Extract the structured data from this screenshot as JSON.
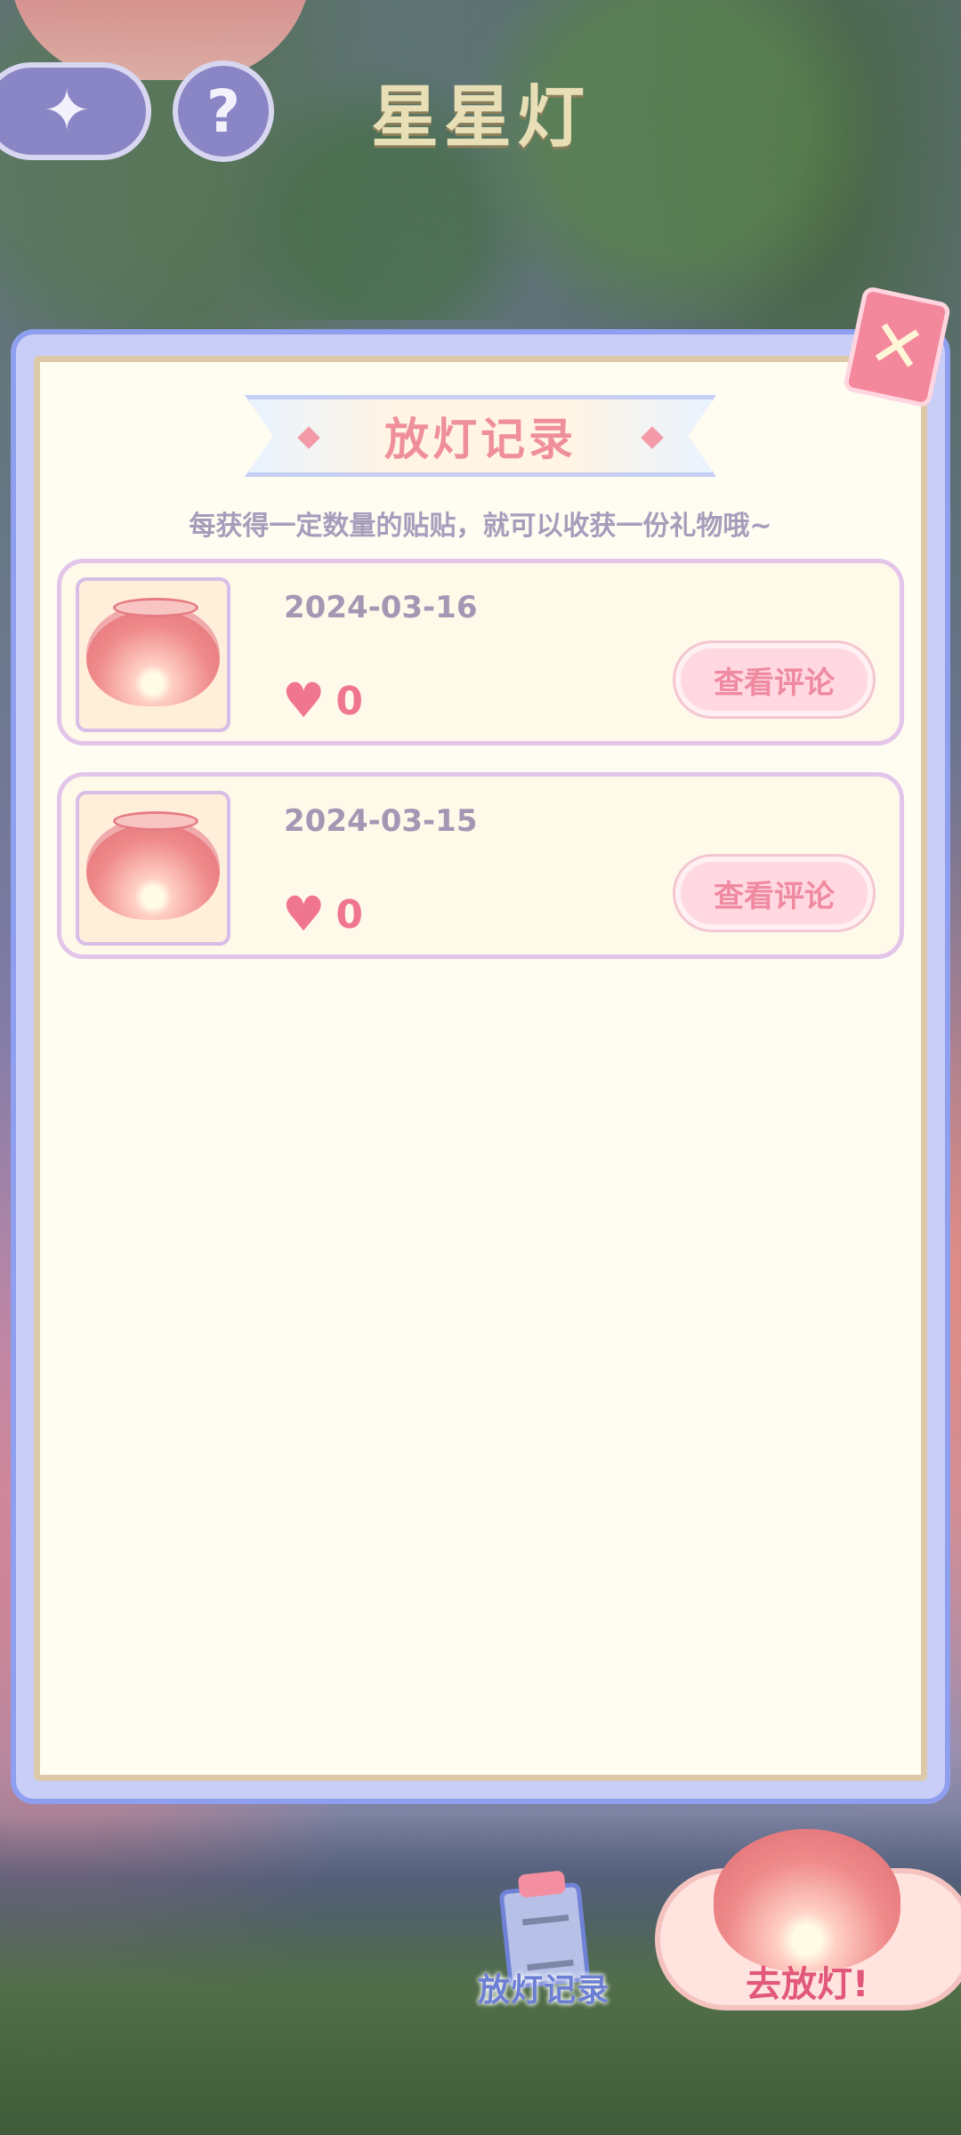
{
  "header": {
    "title": "星星灯",
    "back_icon": "back-arrow-icon",
    "help_label": "?"
  },
  "panel": {
    "banner_title": "放灯记录",
    "subtitle": "每获得一定数量的贴贴，就可以收获一份礼物哦~",
    "close_label": "✕"
  },
  "records": [
    {
      "date": "2024-03-16",
      "likes": "0",
      "button": "查看评论"
    },
    {
      "date": "2024-03-15",
      "likes": "0",
      "button": "查看评论"
    }
  ],
  "bottom": {
    "records_button": "放灯记录",
    "launch_button": "去放灯!"
  },
  "colors": {
    "accent_pink": "#ef8f9c",
    "panel_border": "#8f9ff0",
    "title_gold": "#e8dfb6"
  }
}
